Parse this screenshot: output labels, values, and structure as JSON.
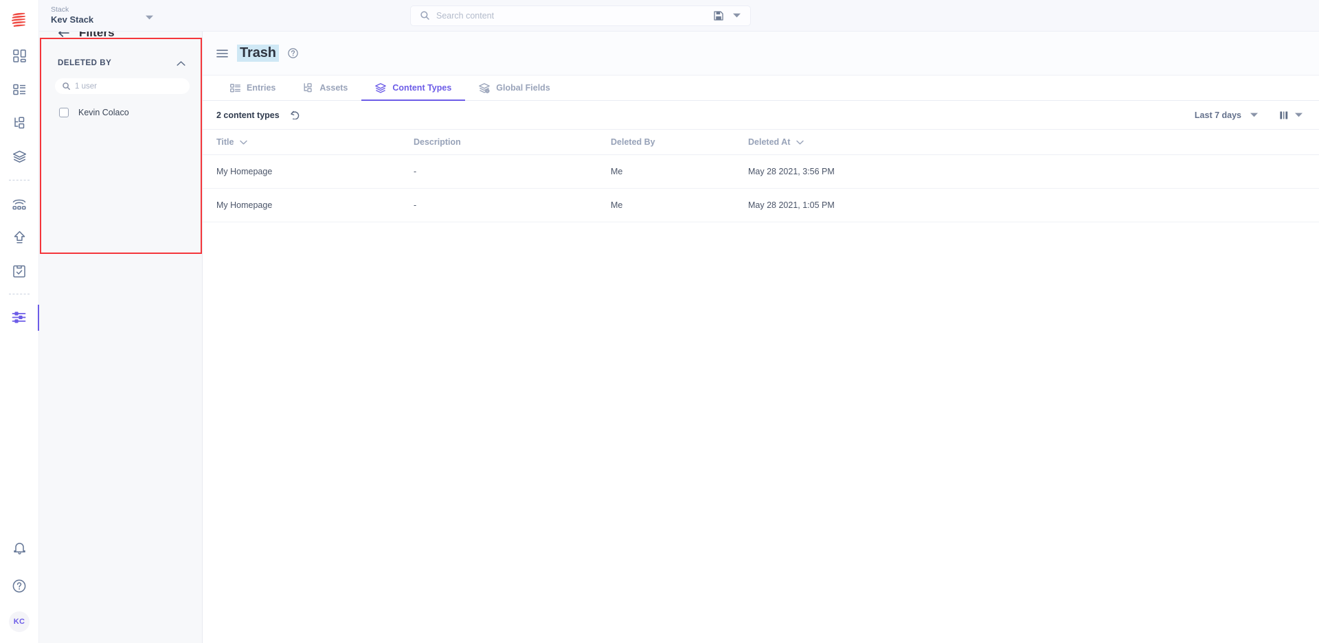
{
  "rail": {
    "logo_name": "contentstack-logo",
    "items": [
      {
        "name": "dashboard-icon",
        "label": "Dashboard"
      },
      {
        "name": "entries-icon",
        "label": "Entries"
      },
      {
        "name": "assets-icon",
        "label": "Assets"
      },
      {
        "name": "content-types-icon",
        "label": "Content Types"
      },
      {
        "name": "publish-queue-icon",
        "label": "Publish Queue"
      },
      {
        "name": "release-icon",
        "label": "Releases"
      },
      {
        "name": "workflow-icon",
        "label": "Workflows"
      },
      {
        "name": "trash-filters-icon",
        "label": "Trash"
      }
    ],
    "bottom": [
      {
        "name": "bell-icon",
        "label": "Notifications"
      },
      {
        "name": "help-icon",
        "label": "Help"
      }
    ],
    "avatar_initials": "KC"
  },
  "topbar": {
    "stack_label": "Stack",
    "stack_name": "Kev Stack",
    "stack_caret": "chevron-down-icon",
    "search": {
      "placeholder": "Search content",
      "value": "",
      "search_icon": "search-icon",
      "save_icon": "save-icon",
      "caret_icon": "chevron-down-icon"
    }
  },
  "filters": {
    "back_icon": "arrow-left-icon",
    "title": "Filters",
    "section": {
      "label": "DELETED BY",
      "collapse_icon": "chevron-up-icon",
      "search_placeholder": "1 user",
      "search_value": "",
      "options": [
        {
          "label": "Kevin Colaco",
          "checked": false
        }
      ]
    },
    "highlight_color": "#f4353a"
  },
  "page": {
    "menu_icon": "hamburger-icon",
    "title": "Trash",
    "help_icon": "help-circle-icon",
    "title_highlight_color": "#cfe8f5"
  },
  "tabs": {
    "active": "Content Types",
    "accent_color": "#6c5ce7",
    "items": [
      {
        "label": "Entries",
        "icon": "entries-icon",
        "active": false
      },
      {
        "label": "Assets",
        "icon": "assets-icon",
        "active": false
      },
      {
        "label": "Content Types",
        "icon": "content-types-icon",
        "active": true
      },
      {
        "label": "Global Fields",
        "icon": "global-fields-icon",
        "active": false
      }
    ]
  },
  "toolbar": {
    "count_label": "2 content types",
    "refresh_icon": "refresh-icon",
    "date_range": "Last 7 days",
    "date_range_caret": "chevron-down-icon",
    "columns_icon": "columns-icon",
    "columns_caret": "chevron-down-icon"
  },
  "table": {
    "columns": [
      {
        "label": "Title",
        "sortable": true
      },
      {
        "label": "Description",
        "sortable": false
      },
      {
        "label": "Deleted By",
        "sortable": false
      },
      {
        "label": "Deleted At",
        "sortable": true
      }
    ],
    "rows": [
      {
        "title": "My Homepage",
        "description": "-",
        "deleted_by": "Me",
        "deleted_at": "May 28 2021, 3:56 PM"
      },
      {
        "title": "My Homepage",
        "description": "-",
        "deleted_by": "Me",
        "deleted_at": "May 28 2021, 1:05 PM"
      }
    ]
  }
}
